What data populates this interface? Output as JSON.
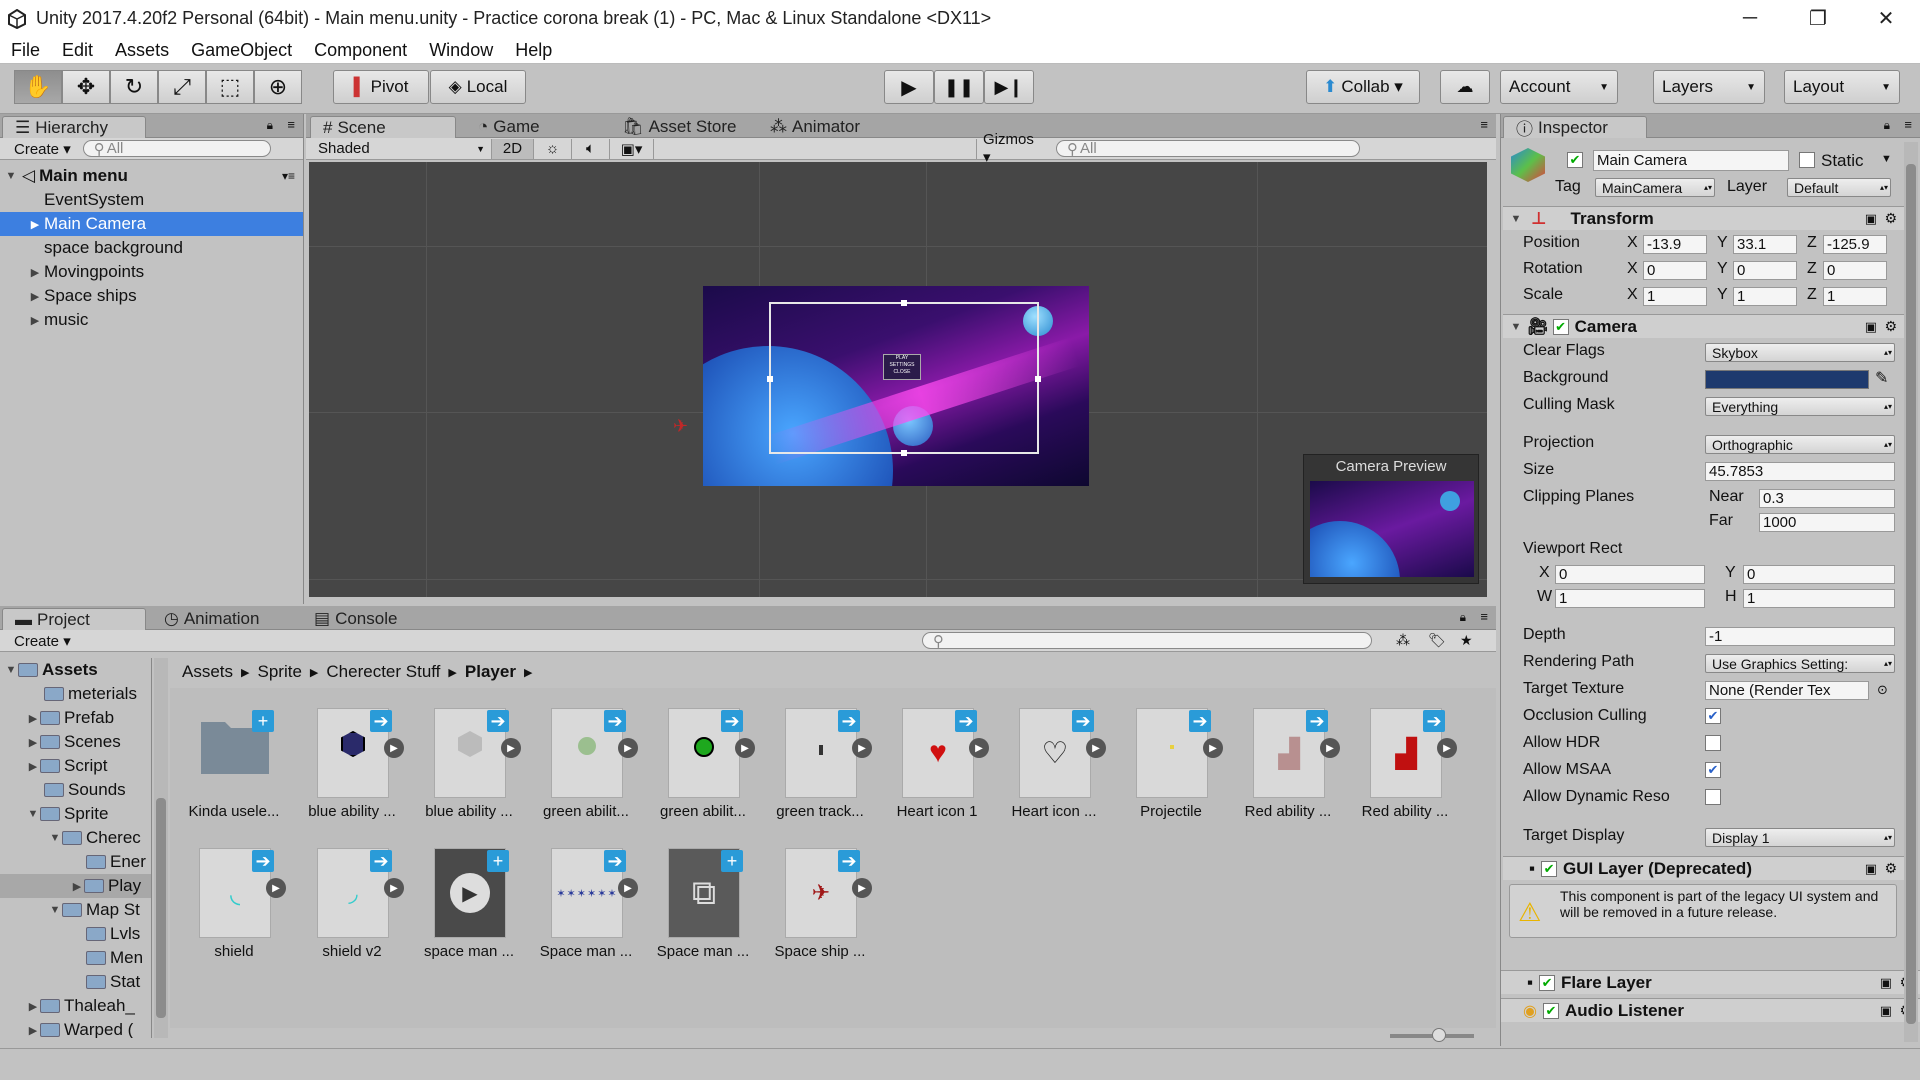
{
  "window": {
    "title": "Unity 2017.4.20f2 Personal (64bit) - Main menu.unity - Practice corona break (1) - PC, Mac & Linux Standalone <DX11>"
  },
  "menu": [
    "File",
    "Edit",
    "Assets",
    "GameObject",
    "Component",
    "Window",
    "Help"
  ],
  "toolbar": {
    "pivot": "Pivot",
    "local": "Local",
    "collab": "Collab ▾",
    "account": "Account",
    "layers": "Layers",
    "layout": "Layout"
  },
  "hierarchy": {
    "tab": "Hierarchy",
    "create": "Create ▾",
    "search": "All",
    "scene": "Main menu",
    "items": [
      {
        "label": "EventSystem"
      },
      {
        "label": "Main Camera"
      },
      {
        "label": "space background"
      },
      {
        "label": "Movingpoints"
      },
      {
        "label": "Space ships"
      },
      {
        "label": "music"
      }
    ]
  },
  "scene_tabs": {
    "scene": "Scene",
    "game": "Game",
    "store": "Asset Store",
    "animator": "Animator",
    "shaded": "Shaded",
    "two_d": "2D",
    "gizmos": "Gizmos ▾",
    "search": "All",
    "camera_preview": "Camera Preview",
    "sprite_text": "PLAY\nSETTINGS\nCLOSE"
  },
  "project": {
    "tabs": [
      "Project",
      "Animation",
      "Console"
    ],
    "create": "Create ▾",
    "breadcrumb": [
      "Assets",
      "Sprite",
      "Cherecter Stuff",
      "Player"
    ],
    "tree": [
      {
        "label": "Assets"
      },
      {
        "label": "meterials"
      },
      {
        "label": "Prefab"
      },
      {
        "label": "Scenes"
      },
      {
        "label": "Script"
      },
      {
        "label": "Sounds"
      },
      {
        "label": "Sprite"
      },
      {
        "label": "Cherec"
      },
      {
        "label": "Ener"
      },
      {
        "label": "Play"
      },
      {
        "label": "Map St"
      },
      {
        "label": "Lvls"
      },
      {
        "label": "Men"
      },
      {
        "label": "Stat"
      },
      {
        "label": "Thaleah_"
      },
      {
        "label": "Warped ("
      }
    ],
    "assets": [
      {
        "label": "Kinda usele..."
      },
      {
        "label": "blue ability ..."
      },
      {
        "label": "blue ability ..."
      },
      {
        "label": "green abilit..."
      },
      {
        "label": "green abilit..."
      },
      {
        "label": "green track..."
      },
      {
        "label": "Heart icon 1"
      },
      {
        "label": "Heart icon ..."
      },
      {
        "label": "Projectile"
      },
      {
        "label": "Red ability ..."
      },
      {
        "label": "Red ability ..."
      },
      {
        "label": "shield"
      },
      {
        "label": "shield v2"
      },
      {
        "label": "space man ..."
      },
      {
        "label": "Space man ..."
      },
      {
        "label": "Space man ..."
      },
      {
        "label": "Space ship ..."
      }
    ]
  },
  "inspector": {
    "tab": "Inspector",
    "name": "Main Camera",
    "static": "Static",
    "tag_label": "Tag",
    "tag": "MainCamera",
    "layer_label": "Layer",
    "layer": "Default",
    "transform": {
      "title": "Transform",
      "position_label": "Position",
      "rotation_label": "Rotation",
      "scale_label": "Scale",
      "position": {
        "x": "-13.9",
        "y": "33.1",
        "z": "-125.9"
      },
      "rotation": {
        "x": "0",
        "y": "0",
        "z": "0"
      },
      "scale": {
        "x": "1",
        "y": "1",
        "z": "1"
      },
      "x": "X",
      "y": "Y",
      "z": "Z"
    },
    "camera": {
      "title": "Camera",
      "clear_flags_label": "Clear Flags",
      "clear_flags": "Skybox",
      "background_label": "Background",
      "background_color": "#1e3a6e",
      "culling_mask_label": "Culling Mask",
      "culling_mask": "Everything",
      "projection_label": "Projection",
      "projection": "Orthographic",
      "size_label": "Size",
      "size": "45.7853",
      "clipping_label": "Clipping Planes",
      "near_label": "Near",
      "near": "0.3",
      "far_label": "Far",
      "far": "1000",
      "viewport_label": "Viewport Rect",
      "vx": "0",
      "vy": "0",
      "vw": "1",
      "vh": "1",
      "x": "X",
      "y": "Y",
      "w": "W",
      "h": "H",
      "depth_label": "Depth",
      "depth": "-1",
      "rendering_path_label": "Rendering Path",
      "rendering_path": "Use Graphics Setting:",
      "target_texture_label": "Target Texture",
      "target_texture": "None (Render Tex",
      "occlusion_label": "Occlusion Culling",
      "hdr_label": "Allow HDR",
      "msaa_label": "Allow MSAA",
      "dynres_label": "Allow Dynamic Reso",
      "target_display_label": "Target Display",
      "target_display": "Display 1"
    },
    "gui_layer": {
      "title": "GUI Layer (Deprecated)",
      "warning": "This component is part of the legacy UI system and will be removed in a future release."
    },
    "flare_layer": {
      "title": "Flare Layer"
    },
    "audio_listener": {
      "title": "Audio Listener"
    }
  }
}
